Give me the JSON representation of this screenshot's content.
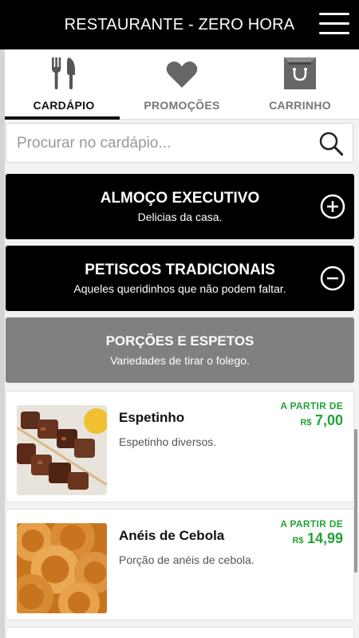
{
  "header": {
    "title": "RESTAURANTE - ZERO HORA",
    "menu_icon": "hamburger-menu-icon"
  },
  "tabs": [
    {
      "label": "CARDÁPIO",
      "icon": "fork-knife-icon",
      "active": true
    },
    {
      "label": "PROMOÇÕES",
      "icon": "heart-icon",
      "active": false
    },
    {
      "label": "CARRINHO",
      "icon": "shopping-bag-icon",
      "active": false
    }
  ],
  "search": {
    "placeholder": "Procurar no cardápio...",
    "value": "",
    "icon": "search-icon"
  },
  "categories": [
    {
      "title": "ALMOÇO EXECUTIVO",
      "subtitle": "Delicias da casa.",
      "state": "collapsed",
      "icon": "plus-circle-icon"
    },
    {
      "title": "PETISCOS TRADICIONAIS",
      "subtitle": "Aqueles queridinhos que não podem faltar.",
      "state": "expanded",
      "icon": "minus-circle-icon"
    },
    {
      "title": "PORÇÕES E ESPETOS",
      "subtitle": "Variedades de tirar o folego.",
      "state": "selected"
    }
  ],
  "items": [
    {
      "name": "Espetinho",
      "description": "Espetinho diversos.",
      "from_label": "A PARTIR DE",
      "currency": "R$",
      "price": "7,00"
    },
    {
      "name": "Anéis de Cebola",
      "description": "Porção de anéis de cebola.",
      "from_label": "A PARTIR DE",
      "currency": "R$",
      "price": "14,99"
    }
  ],
  "colors": {
    "header_bg": "#000000",
    "category_bg": "#000000",
    "category_selected_bg": "#808080",
    "price": "#23a336"
  }
}
